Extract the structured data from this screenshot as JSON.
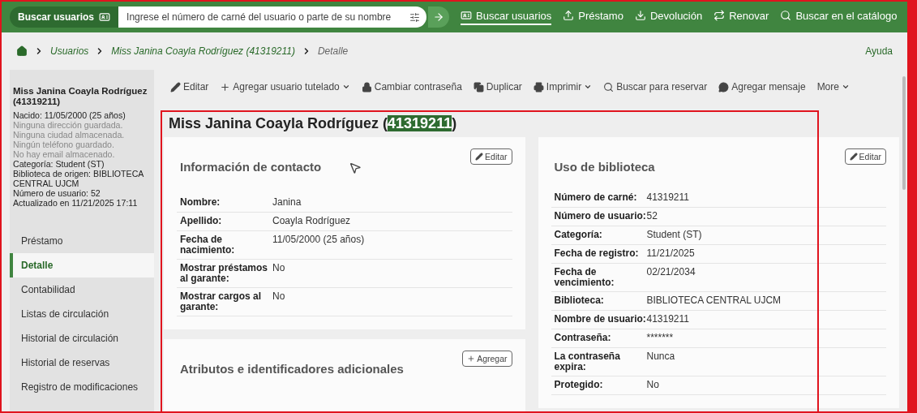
{
  "topbar": {
    "search_label": "Buscar usuarios",
    "search": {
      "placeholder": "Ingrese el número de carné del usuario o parte de su nombre"
    },
    "links": [
      {
        "label": "Buscar usuarios",
        "selected": true
      },
      {
        "label": "Préstamo",
        "selected": false
      },
      {
        "label": "Devolución",
        "selected": false
      },
      {
        "label": "Renovar",
        "selected": false
      },
      {
        "label": "Buscar en el catálogo",
        "selected": false
      }
    ]
  },
  "breadcrumb": {
    "items": [
      "Usuarios",
      "Miss Janina Coayla Rodríguez (41319211)",
      "Detalle"
    ],
    "help": "Ayuda"
  },
  "sidebar": {
    "name": "Miss Janina Coayla Rodríguez (41319211)",
    "lines": [
      {
        "text": "Nacido: 11/05/2000 (25 años)",
        "muted": false
      },
      {
        "text": "Ninguna dirección guardada.",
        "muted": true
      },
      {
        "text": "Ninguna ciudad almacenada.",
        "muted": true
      },
      {
        "text": "Ningún teléfono guardado.",
        "muted": true
      },
      {
        "text": "No hay email almacenado.",
        "muted": true
      },
      {
        "text": "Categoría: Student (ST)",
        "muted": false
      },
      {
        "text": "Biblioteca de origen: BIBLIOTECA CENTRAL UJCM",
        "muted": false
      },
      {
        "text": "Número de usuario: 52",
        "muted": false
      },
      {
        "text": "Actualizado en 11/21/2025 17:11",
        "muted": false
      }
    ],
    "nav": [
      {
        "label": "Préstamo",
        "selected": false
      },
      {
        "label": "Detalle",
        "selected": true
      },
      {
        "label": "Contabilidad",
        "selected": false
      },
      {
        "label": "Listas de circulación",
        "selected": false
      },
      {
        "label": "Historial de circulación",
        "selected": false
      },
      {
        "label": "Historial de reservas",
        "selected": false
      },
      {
        "label": "Registro de modificaciones",
        "selected": false
      }
    ]
  },
  "toolbar": [
    {
      "label": "Editar",
      "dropdown": false
    },
    {
      "label": "Agregar usuario tutelado",
      "dropdown": true
    },
    {
      "label": "Cambiar contraseña",
      "dropdown": false
    },
    {
      "label": "Duplicar",
      "dropdown": false
    },
    {
      "label": "Imprimir",
      "dropdown": true
    },
    {
      "label": "Buscar para reservar",
      "dropdown": false
    },
    {
      "label": "Agregar mensaje",
      "dropdown": false
    },
    {
      "label": "More",
      "dropdown": true
    }
  ],
  "heading": {
    "prefix": "Miss Janina Coayla Rodríguez (",
    "highlight": "41319211",
    "suffix": ")"
  },
  "contact": {
    "title": "Información de contacto",
    "button": "Editar",
    "rows": [
      {
        "label": "Nombre:",
        "value": "Janina"
      },
      {
        "label": "Apellido:",
        "value": "Coayla Rodríguez"
      },
      {
        "label": "Fecha de nacimiento:",
        "value": "11/05/2000 (25 años)"
      },
      {
        "label": "Mostrar préstamos al garante:",
        "value": "No"
      },
      {
        "label": "Mostrar cargos al garante:",
        "value": "No"
      }
    ]
  },
  "attributes": {
    "title": "Atributos e identificadores adicionales",
    "button": "Agregar"
  },
  "library": {
    "title": "Uso de biblioteca",
    "button": "Editar",
    "rows": [
      {
        "label": "Número de carné:",
        "value": "41319211"
      },
      {
        "label": "Número de usuario:",
        "value": "52"
      },
      {
        "label": "Categoría:",
        "value": "Student (ST)"
      },
      {
        "label": "Fecha de registro:",
        "value": "11/21/2025"
      },
      {
        "label": "Fecha de vencimiento:",
        "value": "02/21/2034"
      },
      {
        "label": "Biblioteca:",
        "value": "BIBLIOTECA CENTRAL UJCM"
      },
      {
        "label": "Nombre de usuario:",
        "value": "41319211"
      },
      {
        "label": "Contraseña:",
        "value": "*******"
      },
      {
        "label": "La contraseña expira:",
        "value": "Nunca"
      },
      {
        "label": "Protegido:",
        "value": "No"
      }
    ]
  }
}
